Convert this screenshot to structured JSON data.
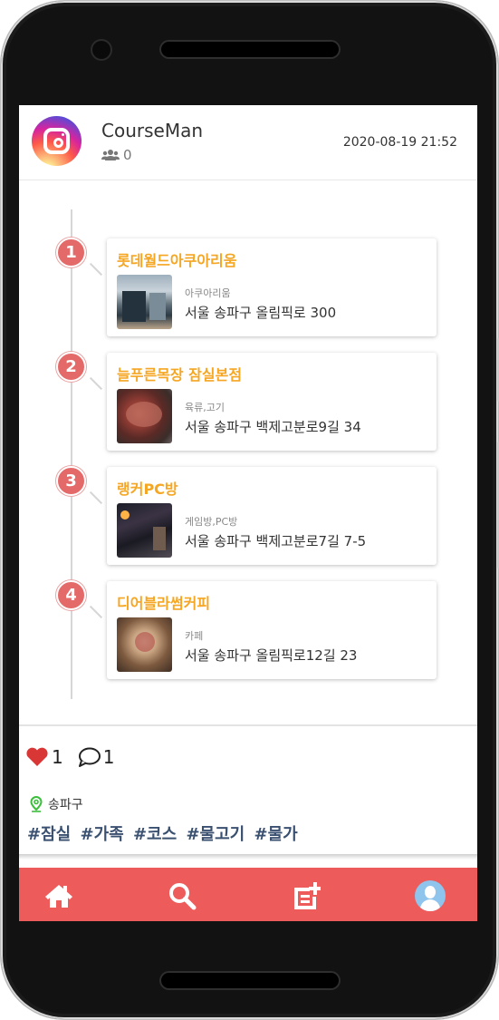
{
  "post": {
    "username": "CourseMan",
    "followers": "0",
    "date": "2020-08-19 21:52",
    "likes": "1",
    "comments": "1",
    "location": "송파구",
    "tags": [
      "#잠실",
      "#가족",
      "#코스",
      "#물고기",
      "#물가"
    ]
  },
  "stops": [
    {
      "num": "1",
      "title": "롯데월드아쿠아리움",
      "category": "아쿠아리움",
      "address": "서울 송파구 올림픽로 300"
    },
    {
      "num": "2",
      "title": "늘푸른목장 잠실본점",
      "category": "육류,고기",
      "address": "서울 송파구 백제고분로9길 34"
    },
    {
      "num": "3",
      "title": "랭커PC방",
      "category": "게임방,PC방",
      "address": "서울 송파구 백제고분로7길 7-5"
    },
    {
      "num": "4",
      "title": "디어블라썸커피",
      "category": "카페",
      "address": "서울 송파구 올림픽로12길 23"
    }
  ],
  "icons": {
    "followers": "users-icon",
    "like": "heart-icon",
    "comment": "comment-icon",
    "location": "map-marker-icon",
    "nav": [
      "home-icon",
      "search-icon",
      "new-post-icon",
      "profile-avatar-icon"
    ]
  },
  "colors": {
    "accent": "#ee5b5b",
    "stop_title": "#f5a623",
    "tag": "#3a5070",
    "location_pin": "#3bbf3b"
  }
}
